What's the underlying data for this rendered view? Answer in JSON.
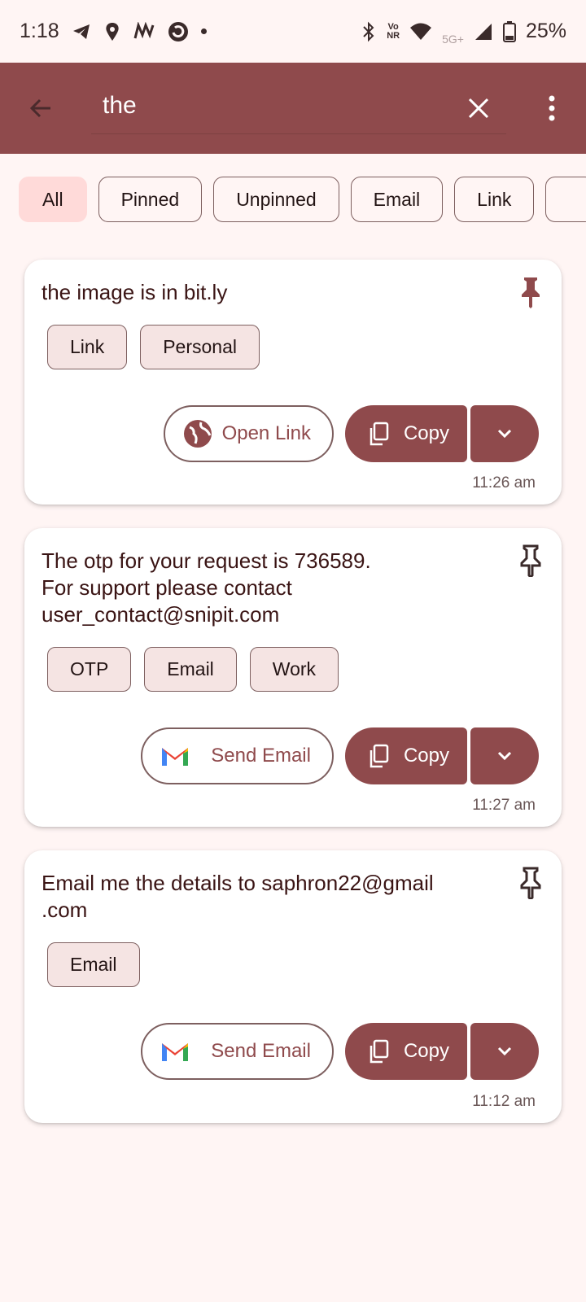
{
  "status_bar": {
    "time": "1:18",
    "network_top": "Vo",
    "network_bottom": "NR",
    "signal_label": "5G+",
    "battery": "25%"
  },
  "app_bar": {
    "search_value": "the",
    "back_icon": "arrow-back-icon",
    "clear_icon": "close-icon",
    "menu_icon": "more-vert-icon"
  },
  "filters": [
    {
      "label": "All",
      "active": true
    },
    {
      "label": "Pinned",
      "active": false
    },
    {
      "label": "Unpinned",
      "active": false
    },
    {
      "label": "Email",
      "active": false
    },
    {
      "label": "Link",
      "active": false
    },
    {
      "label": "",
      "active": false
    }
  ],
  "clips": [
    {
      "text": "the image is in bit.ly",
      "pinned": true,
      "tags": [
        "Link",
        "Personal"
      ],
      "action_label": "Open Link",
      "action_icon": "globe-icon",
      "copy_label": "Copy",
      "time": "11:26 am"
    },
    {
      "text": "The otp for your request is 736589.\nFor support please contact\nuser_contact@snipit.com",
      "pinned": false,
      "tags": [
        "OTP",
        "Email",
        "Work"
      ],
      "action_label": "Send Email",
      "action_icon": "gmail-icon",
      "copy_label": "Copy",
      "time": "11:27 am"
    },
    {
      "text": "Email me the details to saphron22@gmail\n.com",
      "pinned": false,
      "tags": [
        "Email"
      ],
      "action_label": "Send Email",
      "action_icon": "gmail-icon",
      "copy_label": "Copy",
      "time": "11:12 am"
    }
  ],
  "colors": {
    "primary": "#8f4a4c",
    "background": "#fff5f4",
    "chip_active": "#ffdad9",
    "tag_fill": "#f5e4e3"
  }
}
